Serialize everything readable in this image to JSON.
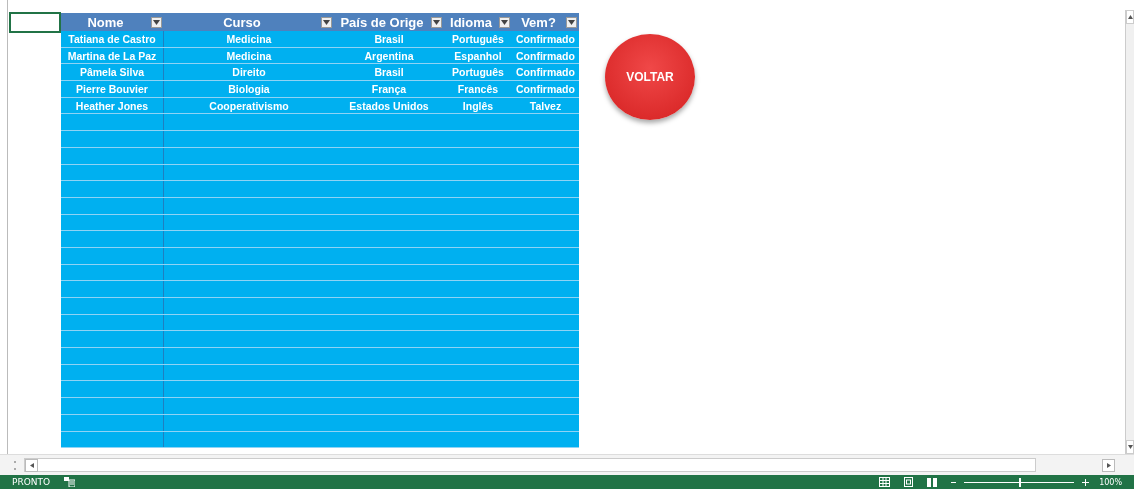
{
  "table": {
    "columns": [
      {
        "label": "Nome"
      },
      {
        "label": "Curso"
      },
      {
        "label": "País de Orige"
      },
      {
        "label": "Idioma"
      },
      {
        "label": "Vem?"
      }
    ],
    "rows": [
      [
        "Tatiana de Castro",
        "Medicina",
        "Brasil",
        "Português",
        "Confirmado"
      ],
      [
        "Martina de La Paz",
        "Medicina",
        "Argentina",
        "Espanhol",
        "Confirmado"
      ],
      [
        "Pâmela Silva",
        "Direito",
        "Brasil",
        "Português",
        "Confirmado"
      ],
      [
        "Pierre Bouvier",
        "Biologia",
        "França",
        "Francês",
        "Confirmado"
      ],
      [
        "Heather Jones",
        "Cooperativismo",
        "Estados Unidos",
        "Inglês",
        "Talvez"
      ]
    ]
  },
  "button": {
    "label": "VOLTAR"
  },
  "status_bar": {
    "status": "PRONTO",
    "zoom": "100%",
    "zoom_slider": {
      "level": 0.5
    }
  }
}
